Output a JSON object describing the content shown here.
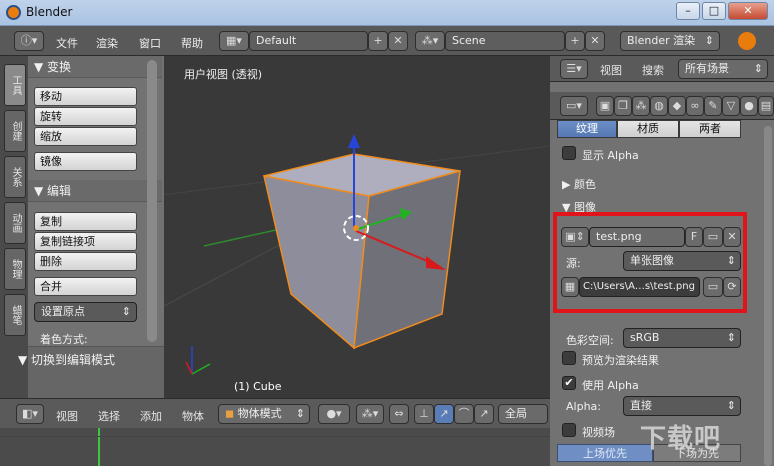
{
  "window": {
    "title": "Blender"
  },
  "topbar": {
    "menus": [
      "文件",
      "渲染",
      "窗口",
      "帮助"
    ],
    "layout_value": "Default",
    "scene_value": "Scene",
    "engine_value": "Blender 渲染"
  },
  "left_tabs": [
    "工具",
    "创建",
    "关系",
    "动画",
    "物理",
    "蜡笔"
  ],
  "toolshelf": {
    "transform_title": "变换",
    "transform_buttons": [
      "移动",
      "旋转",
      "缩放"
    ],
    "mirror_label": "镜像",
    "edit_title": "编辑",
    "edit_buttons": [
      "复制",
      "复制链接项",
      "删除"
    ],
    "join_label": "合并",
    "origin_label": "设置原点",
    "shading_label": "着色方式:",
    "bottom_toggle": "切换到编辑模式"
  },
  "viewport": {
    "view_label": "用户视图 (透视)",
    "object_label": "(1) Cube"
  },
  "viewport_header": {
    "menus": [
      "视图",
      "选择",
      "添加",
      "物体"
    ],
    "mode_value": "物体模式",
    "pivot_value": "全局"
  },
  "properties": {
    "header_menus": [
      "视图",
      "搜索"
    ],
    "scenes_value": "所有场景",
    "tabs": [
      "纹理",
      "材质",
      "两者"
    ],
    "show_alpha_label": "显示 Alpha",
    "colors_section": "颜色",
    "image_section": "图像",
    "image_name": "test.png",
    "image_fake_label": "F",
    "source_label": "源:",
    "source_value": "单张图像",
    "filepath_value": "C:\\Users\\A…s\\test.png",
    "colorspace_label": "色彩空间:",
    "colorspace_value": "sRGB",
    "preview_render_label": "预览为渲染结果",
    "use_alpha_label": "使用 Alpha",
    "alpha_label": "Alpha:",
    "alpha_value": "直接",
    "fields_label": "视频场",
    "upper_first": "上场优先",
    "lower_first": "下场为先"
  },
  "watermark": "下载吧",
  "colors": {
    "highlight_box": "#e0141b",
    "active_tab": "#5a7db8",
    "cube_edge": "#f08c1e"
  }
}
